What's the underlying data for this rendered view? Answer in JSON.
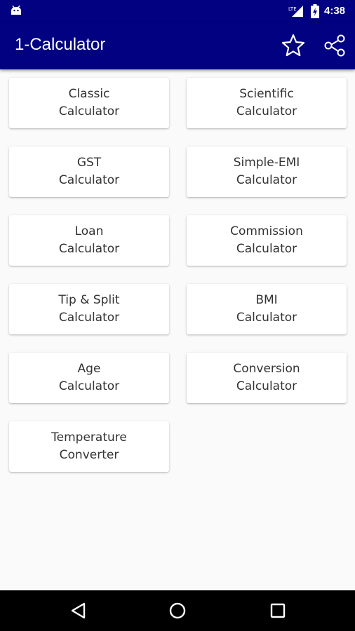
{
  "status_bar": {
    "time": "4:38",
    "network": "LTE"
  },
  "app_bar": {
    "title": "1-Calculator",
    "favorite_icon": "star-outline-icon",
    "share_icon": "share-icon"
  },
  "calculators": [
    {
      "line1": "Classic",
      "line2": "Calculator"
    },
    {
      "line1": "Scientific",
      "line2": "Calculator"
    },
    {
      "line1": "GST",
      "line2": "Calculator"
    },
    {
      "line1": "Simple-EMI",
      "line2": "Calculator"
    },
    {
      "line1": "Loan",
      "line2": "Calculator"
    },
    {
      "line1": "Commission",
      "line2": "Calculator"
    },
    {
      "line1": "Tip & Split",
      "line2": "Calculator"
    },
    {
      "line1": "BMI",
      "line2": "Calculator"
    },
    {
      "line1": "Age",
      "line2": "Calculator"
    },
    {
      "line1": "Conversion",
      "line2": "Calculator"
    },
    {
      "line1": "Temperature",
      "line2": "Converter"
    }
  ],
  "colors": {
    "primary": "#010182",
    "background": "#fafafa",
    "card": "#ffffff",
    "text": "#333333"
  },
  "nav_bar": {
    "back": "back-triangle-icon",
    "home": "home-circle-icon",
    "recents": "recents-square-icon"
  }
}
